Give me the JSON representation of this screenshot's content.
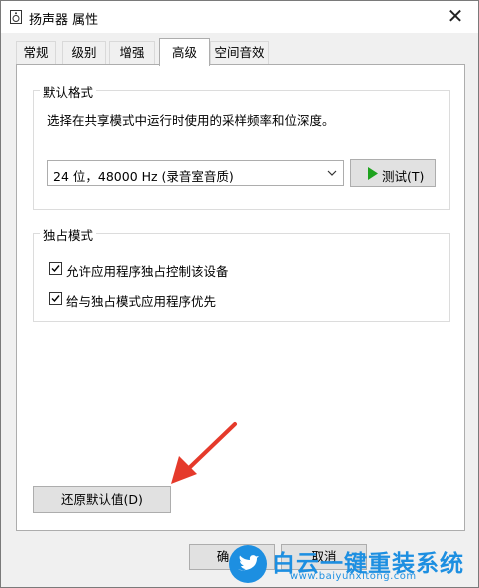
{
  "window": {
    "title": "扬声器 属性",
    "close_glyph": "✕"
  },
  "tabs": [
    {
      "label": "常规"
    },
    {
      "label": "级别"
    },
    {
      "label": "增强"
    },
    {
      "label": "高级"
    },
    {
      "label": "空间音效"
    }
  ],
  "default_format": {
    "group_title": "默认格式",
    "description": "选择在共享模式中运行时使用的采样频率和位深度。",
    "selected_format": "24 位，48000 Hz (录音室音质)",
    "test_button": "测试(T)"
  },
  "exclusive_mode": {
    "group_title": "独占模式",
    "options": [
      {
        "label": "允许应用程序独占控制该设备",
        "checked": true
      },
      {
        "label": "给与独占模式应用程序优先",
        "checked": true
      }
    ]
  },
  "restore_button": "还原默认值(D)",
  "footer": {
    "ok_partial": "确",
    "cancel_partial": "取消"
  },
  "watermark": {
    "title": "白云一键重装系统",
    "url": "www.baiyunxitong.com"
  },
  "colors": {
    "test_icon": "#1fa31f",
    "arrow": "#e53a2b",
    "watermark_blue": "#1d8fe1"
  },
  "icons": [
    "speaker-icon",
    "close-icon",
    "chevron-down-icon",
    "play-icon",
    "checkmark-icon",
    "arrow-icon",
    "twitter-bird-icon"
  ]
}
